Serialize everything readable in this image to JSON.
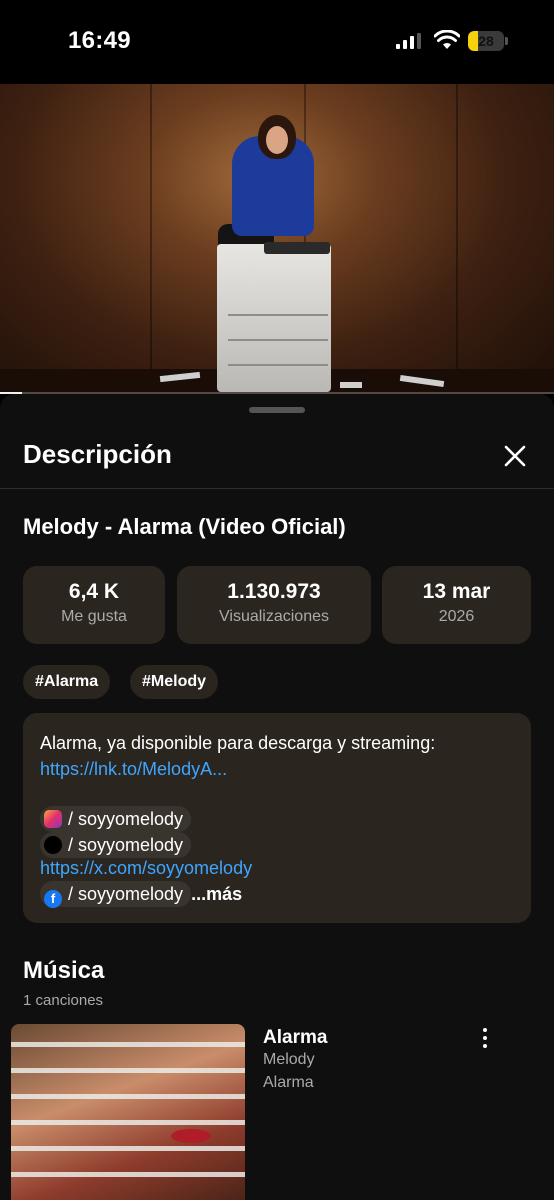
{
  "status_bar": {
    "time": "16:49",
    "battery": "28",
    "battery_level": 0.28
  },
  "video": {
    "progress": 0.04
  },
  "sheet": {
    "title": "Descripción",
    "video_title": "Melody - Alarma (Video Oficial)",
    "stats": [
      {
        "value": "6,4 K",
        "label": "Me gusta"
      },
      {
        "value": "1.130.973",
        "label": "Visualizaciones"
      },
      {
        "value": "13 mar",
        "label": "2026"
      }
    ],
    "tags": [
      "#Alarma",
      "#Melody"
    ],
    "description": {
      "line1": "Alarma, ya disponible para descarga y streaming:",
      "link1": "https://lnk.to/MelodyA...",
      "instagram": "/ soyyomelody",
      "tiktok": "/ soyyomelody",
      "x_link": "https://x.com/soyyomelody",
      "facebook": "/ soyyomelody",
      "more": "...más"
    },
    "music": {
      "title": "Música",
      "count": "1 canciones",
      "song": {
        "title": "Alarma",
        "artist": "Melody",
        "album": "Alarma"
      }
    }
  },
  "icons": {
    "close": "close-icon",
    "instagram": "instagram-icon",
    "tiktok": "tiktok-icon",
    "facebook": "facebook-icon",
    "more": "more-vert-icon"
  },
  "colors": {
    "link": "#3ea6ff",
    "card": "#2b251f",
    "battery": "#f5d20c"
  }
}
